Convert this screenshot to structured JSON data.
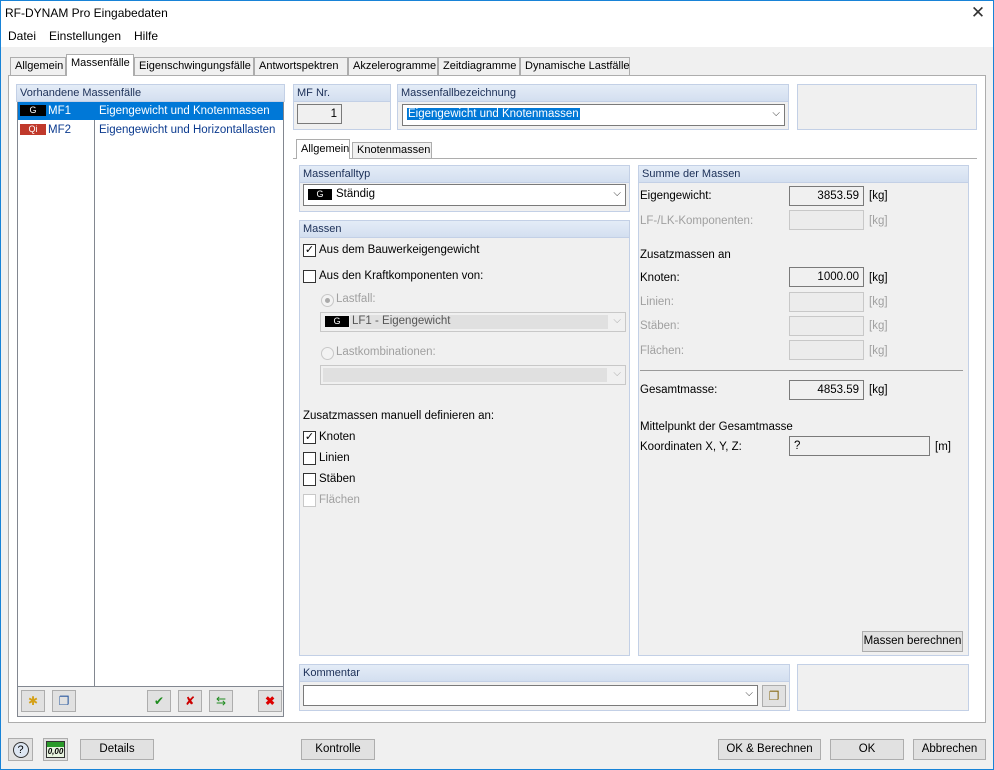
{
  "window": {
    "title": "RF-DYNAM Pro Eingabedaten"
  },
  "menu": [
    "Datei",
    "Einstellungen",
    "Hilfe"
  ],
  "main_tabs": [
    "Allgemein",
    "Massenfälle",
    "Eigenschwingungsfälle",
    "Antwortspektren",
    "Akzelerogramme",
    "Zeitdiagramme",
    "Dynamische Lastfälle"
  ],
  "mass_cases": {
    "header": "Vorhandene Massenfälle",
    "rows": [
      {
        "badge": "G",
        "badge_color": "#000000",
        "code": "MF1",
        "desc": "Eigengewicht und Knotenmassen",
        "selected": true
      },
      {
        "badge": "Qi",
        "badge_color": "#c0392b",
        "code": "MF2",
        "desc": "Eigengewicht und Horizontallasten",
        "selected": false
      }
    ]
  },
  "mf_nr": {
    "label": "MF Nr.",
    "value": "1"
  },
  "bezeichnung": {
    "label": "Massenfallbezeichnung",
    "value": "Eigengewicht und Knotenmassen"
  },
  "sub_tabs": [
    "Allgemein",
    "Knotenmassen"
  ],
  "massenfalltyp": {
    "label": "Massenfalltyp",
    "badge": "G",
    "value": "Ständig"
  },
  "massen": {
    "label": "Massen",
    "aus_bauwerk": {
      "label": "Aus dem Bauwerkeigengewicht",
      "checked": true
    },
    "aus_kraft": {
      "label": "Aus den Kraftkomponenten von:",
      "checked": false
    },
    "lastfall": {
      "label": "Lastfall:",
      "badge": "G",
      "value": "LF1 - Eigengewicht"
    },
    "lastkombinationen": {
      "label": "Lastkombinationen:"
    },
    "zusatz_label": "Zusatzmassen manuell definieren an:",
    "zusatz": [
      {
        "label": "Knoten",
        "checked": true,
        "disabled": false
      },
      {
        "label": "Linien",
        "checked": false,
        "disabled": false
      },
      {
        "label": "Stäben",
        "checked": false,
        "disabled": false
      },
      {
        "label": "Flächen",
        "checked": false,
        "disabled": true
      }
    ]
  },
  "summe": {
    "label": "Summe der Massen",
    "eigengewicht": {
      "label": "Eigengewicht:",
      "value": "3853.59",
      "unit": "[kg]"
    },
    "lf_lk": {
      "label": "LF-/LK-Komponenten:",
      "value": "",
      "unit": "[kg]"
    },
    "zusatz_label": "Zusatzmassen an",
    "knoten": {
      "label": "Knoten:",
      "value": "1000.00",
      "unit": "[kg]"
    },
    "linien": {
      "label": "Linien:",
      "value": "",
      "unit": "[kg]"
    },
    "staeben": {
      "label": "Stäben:",
      "value": "",
      "unit": "[kg]"
    },
    "flaechen": {
      "label": "Flächen:",
      "value": "",
      "unit": "[kg]"
    },
    "gesamt": {
      "label": "Gesamtmasse:",
      "value": "4853.59",
      "unit": "[kg]"
    },
    "mittelpunkt_label": "Mittelpunkt der Gesamtmasse",
    "koordinaten": {
      "label": "Koordinaten X, Y, Z:",
      "value": "?",
      "unit": "[m]"
    },
    "berechnen_btn": "Massen berechnen"
  },
  "kommentar": {
    "label": "Kommentar",
    "value": ""
  },
  "footer": {
    "details": "Details",
    "kontrolle": "Kontrolle",
    "ok_berechnen": "OK & Berechnen",
    "ok": "OK",
    "abbrechen": "Abbrechen",
    "calc_icon_text": "0,00"
  }
}
